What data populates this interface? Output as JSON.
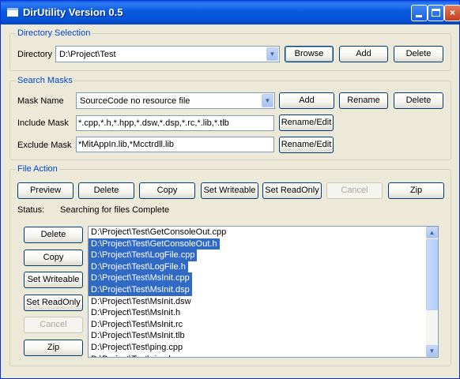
{
  "window": {
    "title": "DirUtility Version 0.5",
    "controls": {
      "minimize": "_",
      "maximize": "□",
      "close": "×"
    }
  },
  "directory_selection": {
    "group_label": "Directory Selection",
    "label": "Directory",
    "value": "D:\\Project\\Test",
    "browse": "Browse",
    "add": "Add",
    "delete": "Delete"
  },
  "search_masks": {
    "group_label": "Search Masks",
    "mask_name_label": "Mask Name",
    "mask_name_value": "SourceCode no resource file",
    "add": "Add",
    "rename": "Rename",
    "delete": "Delete",
    "include_label": "Include Mask",
    "include_value": "*.cpp,*.h,*.hpp,*.dsw,*.dsp,*.rc,*.lib,*.tlb",
    "exclude_label": "Exclude Mask",
    "exclude_value": "*MitAppIn.lib,*Mcctrdll.lib",
    "rename_edit": "Rename/Edit"
  },
  "file_action": {
    "group_label": "File Action",
    "buttons": {
      "preview": "Preview",
      "delete": "Delete",
      "copy": "Copy",
      "set_writeable": "Set Writeable",
      "set_readonly": "Set ReadOnly",
      "cancel": "Cancel",
      "zip": "Zip"
    },
    "status_label": "Status:",
    "status_value": "Searching for files Complete",
    "side_buttons": {
      "delete": "Delete",
      "copy": "Copy",
      "set_writeable": "Set Writeable",
      "set_readonly": "Set ReadOnly",
      "cancel": "Cancel",
      "zip": "Zip"
    },
    "files": [
      {
        "path": "D:\\Project\\Test\\GetConsoleOut.cpp",
        "selected": false
      },
      {
        "path": "D:\\Project\\Test\\GetConsoleOut.h",
        "selected": true
      },
      {
        "path": "D:\\Project\\Test\\LogFile.cpp",
        "selected": true
      },
      {
        "path": "D:\\Project\\Test\\LogFile.h",
        "selected": true
      },
      {
        "path": "D:\\Project\\Test\\MsInit.cpp",
        "selected": true
      },
      {
        "path": "D:\\Project\\Test\\MsInit.dsp",
        "selected": true
      },
      {
        "path": "D:\\Project\\Test\\MsInit.dsw",
        "selected": false
      },
      {
        "path": "D:\\Project\\Test\\MsInit.h",
        "selected": false
      },
      {
        "path": "D:\\Project\\Test\\MsInit.rc",
        "selected": false
      },
      {
        "path": "D:\\Project\\Test\\MsInit.tlb",
        "selected": false
      },
      {
        "path": "D:\\Project\\Test\\ping.cpp",
        "selected": false
      },
      {
        "path": "D:\\Project\\Test\\ping.h",
        "selected": false
      }
    ]
  },
  "icons": {
    "dropdown": "chevron-down-icon",
    "scroll_up": "arrow-up-icon",
    "scroll_down": "arrow-down-icon"
  },
  "colors": {
    "titlebar": "#0552d6",
    "window_bg": "#ece9d8",
    "group_label": "#0046d5",
    "selection": "#316ac5"
  }
}
